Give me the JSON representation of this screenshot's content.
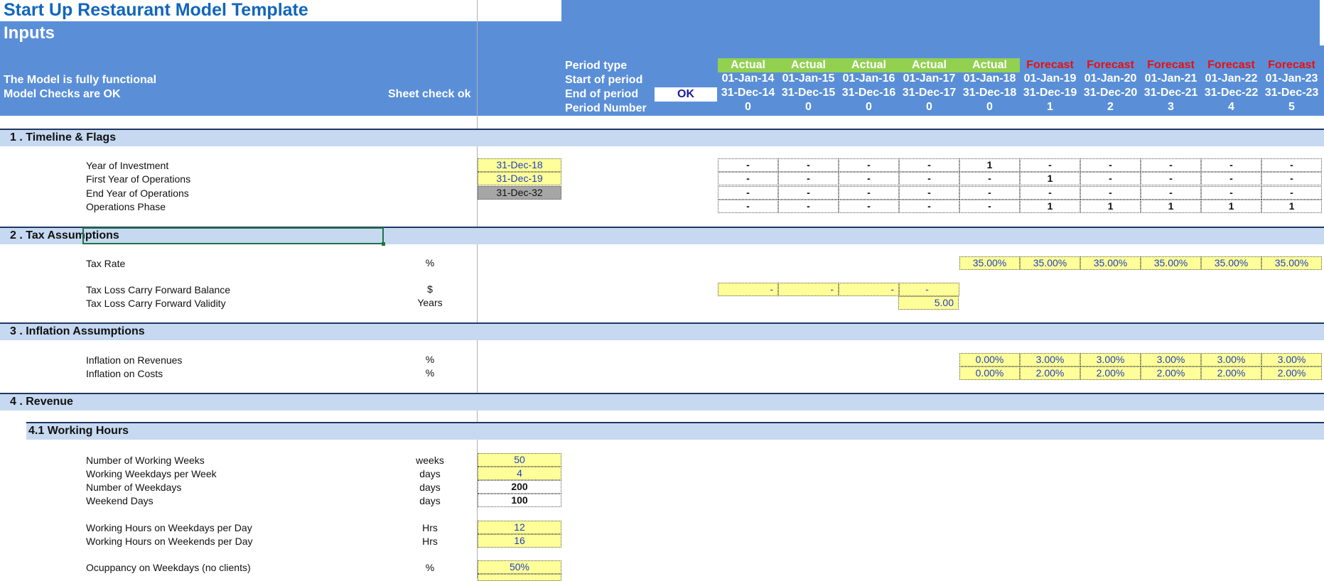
{
  "header": {
    "title": "Start Up Restaurant Model Template",
    "subtitle": "Inputs",
    "status_line1": "The Model is fully functional",
    "status_line2": "Model Checks are OK",
    "sheet_check": "Sheet check ok",
    "row_labels": {
      "period_type": "Period type",
      "start_of_period": "Start of period",
      "end_of_period": "End of period",
      "period_number": "Period Number"
    },
    "ok_label": "OK"
  },
  "periods": [
    {
      "type": "Actual",
      "start": "01-Jan-14",
      "end": "31-Dec-14",
      "num": "0"
    },
    {
      "type": "Actual",
      "start": "01-Jan-15",
      "end": "31-Dec-15",
      "num": "0"
    },
    {
      "type": "Actual",
      "start": "01-Jan-16",
      "end": "31-Dec-16",
      "num": "0"
    },
    {
      "type": "Actual",
      "start": "01-Jan-17",
      "end": "31-Dec-17",
      "num": "0"
    },
    {
      "type": "Actual",
      "start": "01-Jan-18",
      "end": "31-Dec-18",
      "num": "0"
    },
    {
      "type": "Forecast",
      "start": "01-Jan-19",
      "end": "31-Dec-19",
      "num": "1"
    },
    {
      "type": "Forecast",
      "start": "01-Jan-20",
      "end": "31-Dec-20",
      "num": "2"
    },
    {
      "type": "Forecast",
      "start": "01-Jan-21",
      "end": "31-Dec-21",
      "num": "3"
    },
    {
      "type": "Forecast",
      "start": "01-Jan-22",
      "end": "31-Dec-22",
      "num": "4"
    },
    {
      "type": "Forecast",
      "start": "01-Jan-23",
      "end": "31-Dec-23",
      "num": "5"
    }
  ],
  "colors": {
    "header_blue": "#5a8fd8",
    "actual_green": "#92d050",
    "forecast_red": "#e81010",
    "input_yellow": "#ffff99",
    "section_band": "#c6d9f0"
  },
  "sections": {
    "timeline": {
      "title": "1 .  Timeline & Flags",
      "rows": [
        {
          "label": "Year of Investment",
          "input": "31-Dec-18",
          "flags": [
            "-",
            "-",
            "-",
            "-",
            "1",
            "-",
            "-",
            "-",
            "-",
            "-"
          ]
        },
        {
          "label": "First Year of Operations",
          "input": "31-Dec-19",
          "flags": [
            "-",
            "-",
            "-",
            "-",
            "-",
            "1",
            "-",
            "-",
            "-",
            "-"
          ]
        },
        {
          "label": "End Year of Operations",
          "input": "31-Dec-32",
          "flags": [
            "-",
            "-",
            "-",
            "-",
            "-",
            "-",
            "-",
            "-",
            "-",
            "-"
          ]
        },
        {
          "label": "Operations Phase",
          "input": "",
          "flags": [
            "-",
            "-",
            "-",
            "-",
            "-",
            "1",
            "1",
            "1",
            "1",
            "1"
          ]
        }
      ]
    },
    "tax": {
      "title": "2 .  Tax Assumptions",
      "tax_rate": {
        "label": "Tax Rate",
        "unit": "%",
        "values": [
          "35.00%",
          "35.00%",
          "35.00%",
          "35.00%",
          "35.00%",
          "35.00%"
        ]
      },
      "tlcf_balance": {
        "label": "Tax Loss Carry Forward Balance",
        "unit": "$",
        "values": [
          "-",
          "-",
          "-",
          "-"
        ]
      },
      "tlcf_validity": {
        "label": "Tax Loss Carry Forward Validity",
        "unit": "Years",
        "value": "5.00"
      }
    },
    "inflation": {
      "title": "3 .  Inflation Assumptions",
      "revenues": {
        "label": "Inflation on Revenues",
        "unit": "%",
        "values": [
          "0.00%",
          "3.00%",
          "3.00%",
          "3.00%",
          "3.00%",
          "3.00%"
        ]
      },
      "costs": {
        "label": "Inflation on Costs",
        "unit": "%",
        "values": [
          "0.00%",
          "2.00%",
          "2.00%",
          "2.00%",
          "2.00%",
          "2.00%"
        ]
      }
    },
    "revenue": {
      "title": "4 .  Revenue",
      "subtitle": "4.1   Working Hours",
      "rows": [
        {
          "label": "Number of Working Weeks",
          "unit": "weeks",
          "value": "50"
        },
        {
          "label": "Working Weekdays per Week",
          "unit": "days",
          "value": "4"
        },
        {
          "label": "Number of Weekdays",
          "unit": "days",
          "value": "200"
        },
        {
          "label": "Weekend Days",
          "unit": "days",
          "value": "100"
        },
        {
          "label": "Working Hours on Weekdays per Day",
          "unit": "Hrs",
          "value": "12"
        },
        {
          "label": "Working Hours on Weekends per Day",
          "unit": "Hrs",
          "value": "16"
        },
        {
          "label": "Ocuppancy on Weekdays (no clients)",
          "unit": "%",
          "value": "50%"
        }
      ]
    }
  }
}
